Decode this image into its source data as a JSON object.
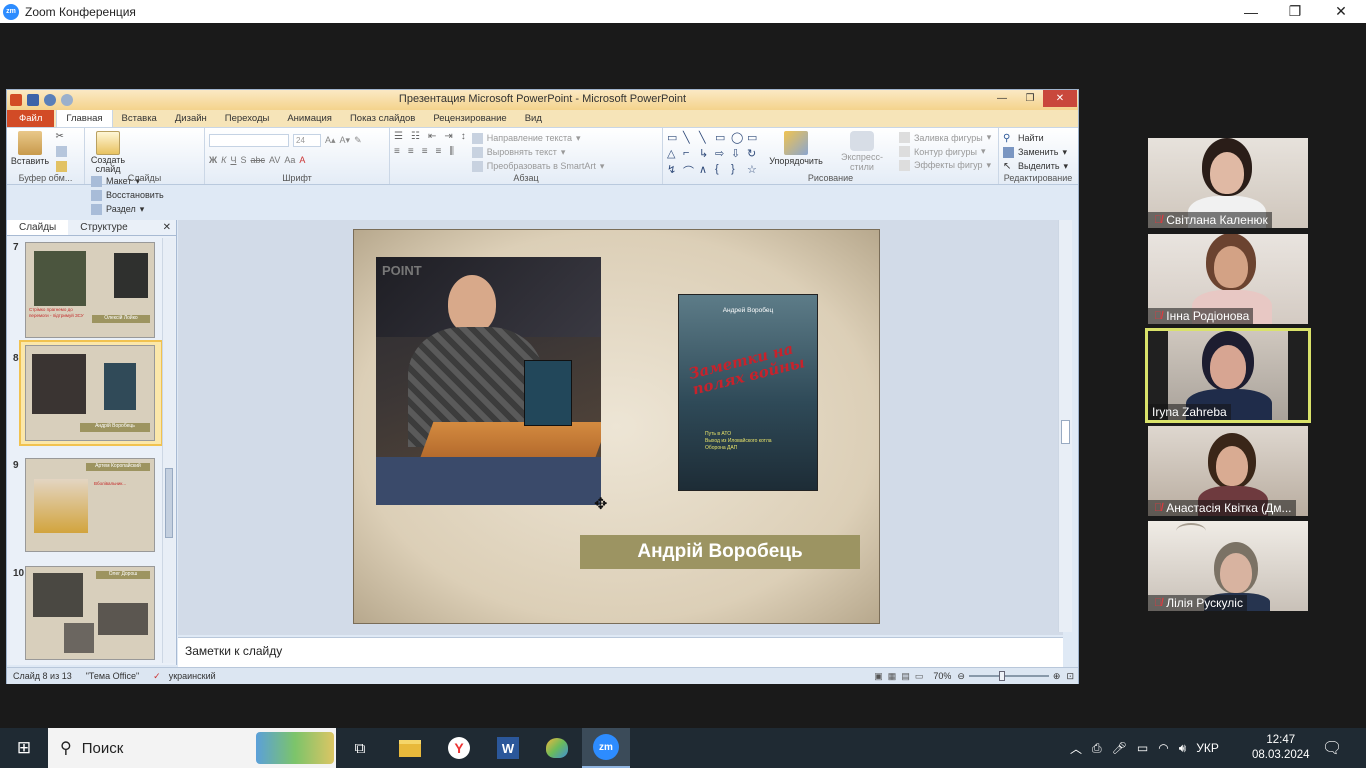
{
  "zoom": {
    "window_title": "Zoom Конференция",
    "logo": "zm",
    "controls": {
      "minimize": "—",
      "restore": "❐",
      "close": "✕"
    }
  },
  "ppt": {
    "window_title": "Презентация Microsoft PowerPoint  -  Microsoft PowerPoint",
    "tabs": [
      "Файл",
      "Главная",
      "Вставка",
      "Дизайн",
      "Переходы",
      "Анимация",
      "Показ слайдов",
      "Рецензирование",
      "Вид"
    ],
    "ribbon": {
      "clipboard": {
        "paste": "Вставить",
        "label": "Буфер обм..."
      },
      "slides": {
        "new_slide": "Создать слайд",
        "layout": "Макет",
        "reset": "Восстановить",
        "section": "Раздел",
        "label": "Слайды"
      },
      "font": {
        "size": "24",
        "label": "Шрифт"
      },
      "paragraph": {
        "text_direction": "Направление текста",
        "align_text": "Выровнять текст",
        "smartart": "Преобразовать в SmartArt",
        "label": "Абзац"
      },
      "drawing": {
        "arrange": "Упорядочить",
        "quick_styles": "Экспресс-стили",
        "fill": "Заливка фигуры",
        "outline": "Контур фигуры",
        "effects": "Эффекты фигур",
        "label": "Рисование"
      },
      "editing": {
        "find": "Найти",
        "replace": "Заменить",
        "select": "Выделить",
        "label": "Редактирование"
      }
    },
    "pane_tabs": [
      "Слайды",
      "Структуре"
    ],
    "thumbnails": [
      {
        "num": "7",
        "caption": "Олексій Лойко",
        "red": "Стрімко прагнемо до перемоги - підтримуй ЗСУ"
      },
      {
        "num": "8",
        "caption": "Андрій Воробець",
        "red": ""
      },
      {
        "num": "9",
        "caption": "Артем Коропайский",
        "red": "Вболівальник..."
      },
      {
        "num": "10",
        "caption": "Олег Дорош",
        "red": ""
      }
    ],
    "slide": {
      "name": "Андрій Воробець",
      "book_author": "Андрей Воробец",
      "book_title": "Заметки на полях войны",
      "book_items": [
        "Путь в АТО",
        "Выход из Иловайского котла",
        "Оборона ДАП"
      ]
    },
    "notes_placeholder": "Заметки к слайду",
    "status": {
      "slide": "Слайд 8 из 13",
      "theme": "\"Тема Office\"",
      "language": "украинский",
      "zoom": "70%"
    }
  },
  "participants": [
    {
      "name": "Світлана Каленюк",
      "muted": true
    },
    {
      "name": "Інна Родіонова",
      "muted": true
    },
    {
      "name": "Iryna Zahreba",
      "muted": false
    },
    {
      "name": "Анастасія Квітка (Дм...",
      "muted": true
    },
    {
      "name": "Лілія Рускуліс",
      "muted": true
    }
  ],
  "taskbar": {
    "search": "Поиск",
    "lang": "УКР",
    "time": "12:47",
    "date": "08.03.2024"
  },
  "colors": {
    "accent": "#f1c24f",
    "zoom_blue": "#2d8cff",
    "ppt_red": "#d24b26",
    "caption": "#9c9462"
  }
}
